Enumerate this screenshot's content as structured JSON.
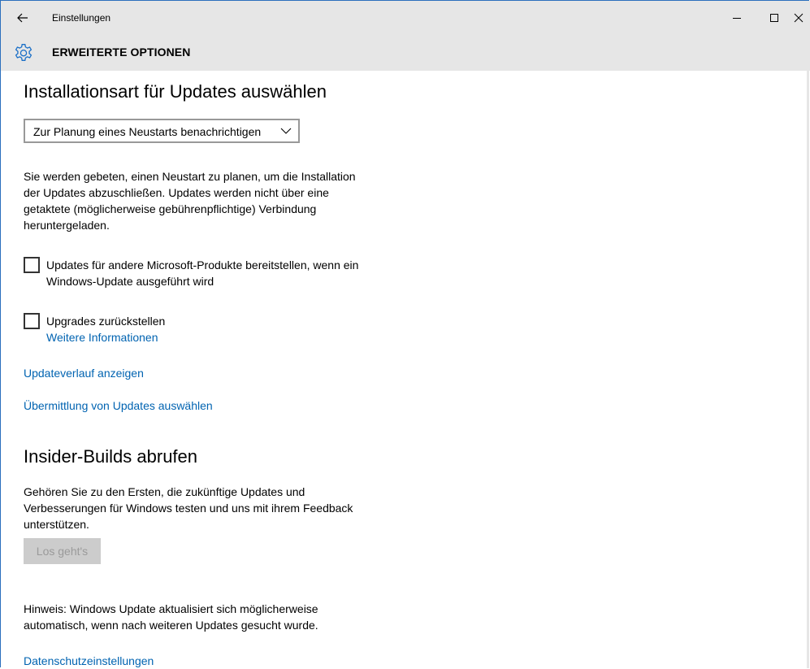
{
  "window": {
    "app_title": "Einstellungen",
    "accent": "#2b6fbd"
  },
  "header": {
    "icon": "gear-icon",
    "title": "ERWEITERTE OPTIONEN"
  },
  "section_install": {
    "heading": "Installationsart für Updates auswählen",
    "dropdown_value": "Zur Planung eines Neustarts benachrichtigen",
    "description_lines": [
      "Sie werden gebeten, einen Neustart zu planen, um die Installation",
      "der Updates abzuschließen. Updates werden nicht über eine",
      "getaktete (möglicherweise gebührenpflichtige) Verbindung",
      "heruntergeladen."
    ]
  },
  "checkboxes": [
    {
      "label_lines": [
        "Updates für andere Microsoft-Produkte bereitstellen, wenn ein",
        "Windows-Update ausgeführt wird"
      ],
      "checked": false
    },
    {
      "label_lines": [
        "Upgrades zurückstellen"
      ],
      "checked": false,
      "link": "Weitere Informationen"
    }
  ],
  "links": {
    "history": "Updateverlauf anzeigen",
    "delivery": "Übermittlung von Updates auswählen",
    "privacy": "Datenschutzeinstellungen"
  },
  "section_insider": {
    "heading": "Insider-Builds abrufen",
    "description_lines": [
      "Gehören Sie zu den Ersten, die zukünftige Updates und",
      "Verbesserungen für Windows testen und uns mit ihrem Feedback",
      "unterstützen."
    ],
    "button_label": "Los geht's",
    "button_enabled": false
  },
  "note": {
    "lines": [
      "Hinweis: Windows Update aktualisiert sich möglicherweise",
      "automatisch, wenn nach weiteren Updates gesucht wurde."
    ]
  },
  "colors": {
    "link": "#0063b1",
    "chrome": "#e6e6e6",
    "disabled_button_bg": "#cccccc",
    "disabled_button_text": "#9a9a9a"
  }
}
